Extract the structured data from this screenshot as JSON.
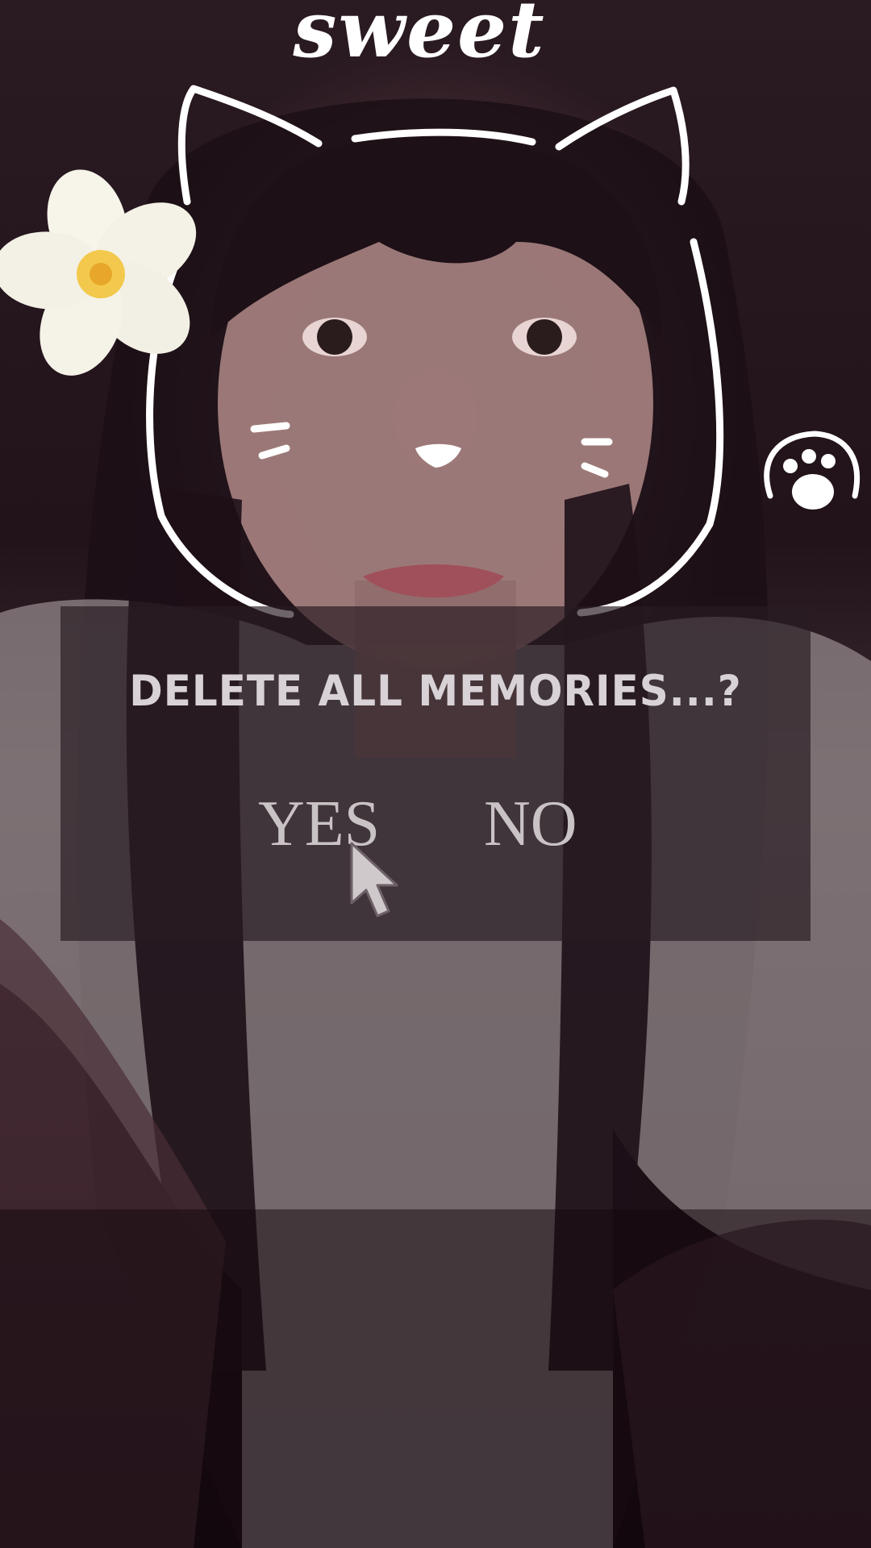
{
  "sticker": {
    "text": "sweet"
  },
  "dialog": {
    "title": "DELETE ALL MEMORIES...?",
    "yes_label": "YES",
    "no_label": "NO"
  },
  "icons": {
    "flower": "flower-icon",
    "cat_ears": "cat-ears-icon",
    "paw": "paw-icon",
    "cursor": "mouse-cursor-icon"
  },
  "colors": {
    "dialog_overlay": "#281c22",
    "dialog_text": "#d8d2d6",
    "button_text": "#c9c3c6"
  }
}
